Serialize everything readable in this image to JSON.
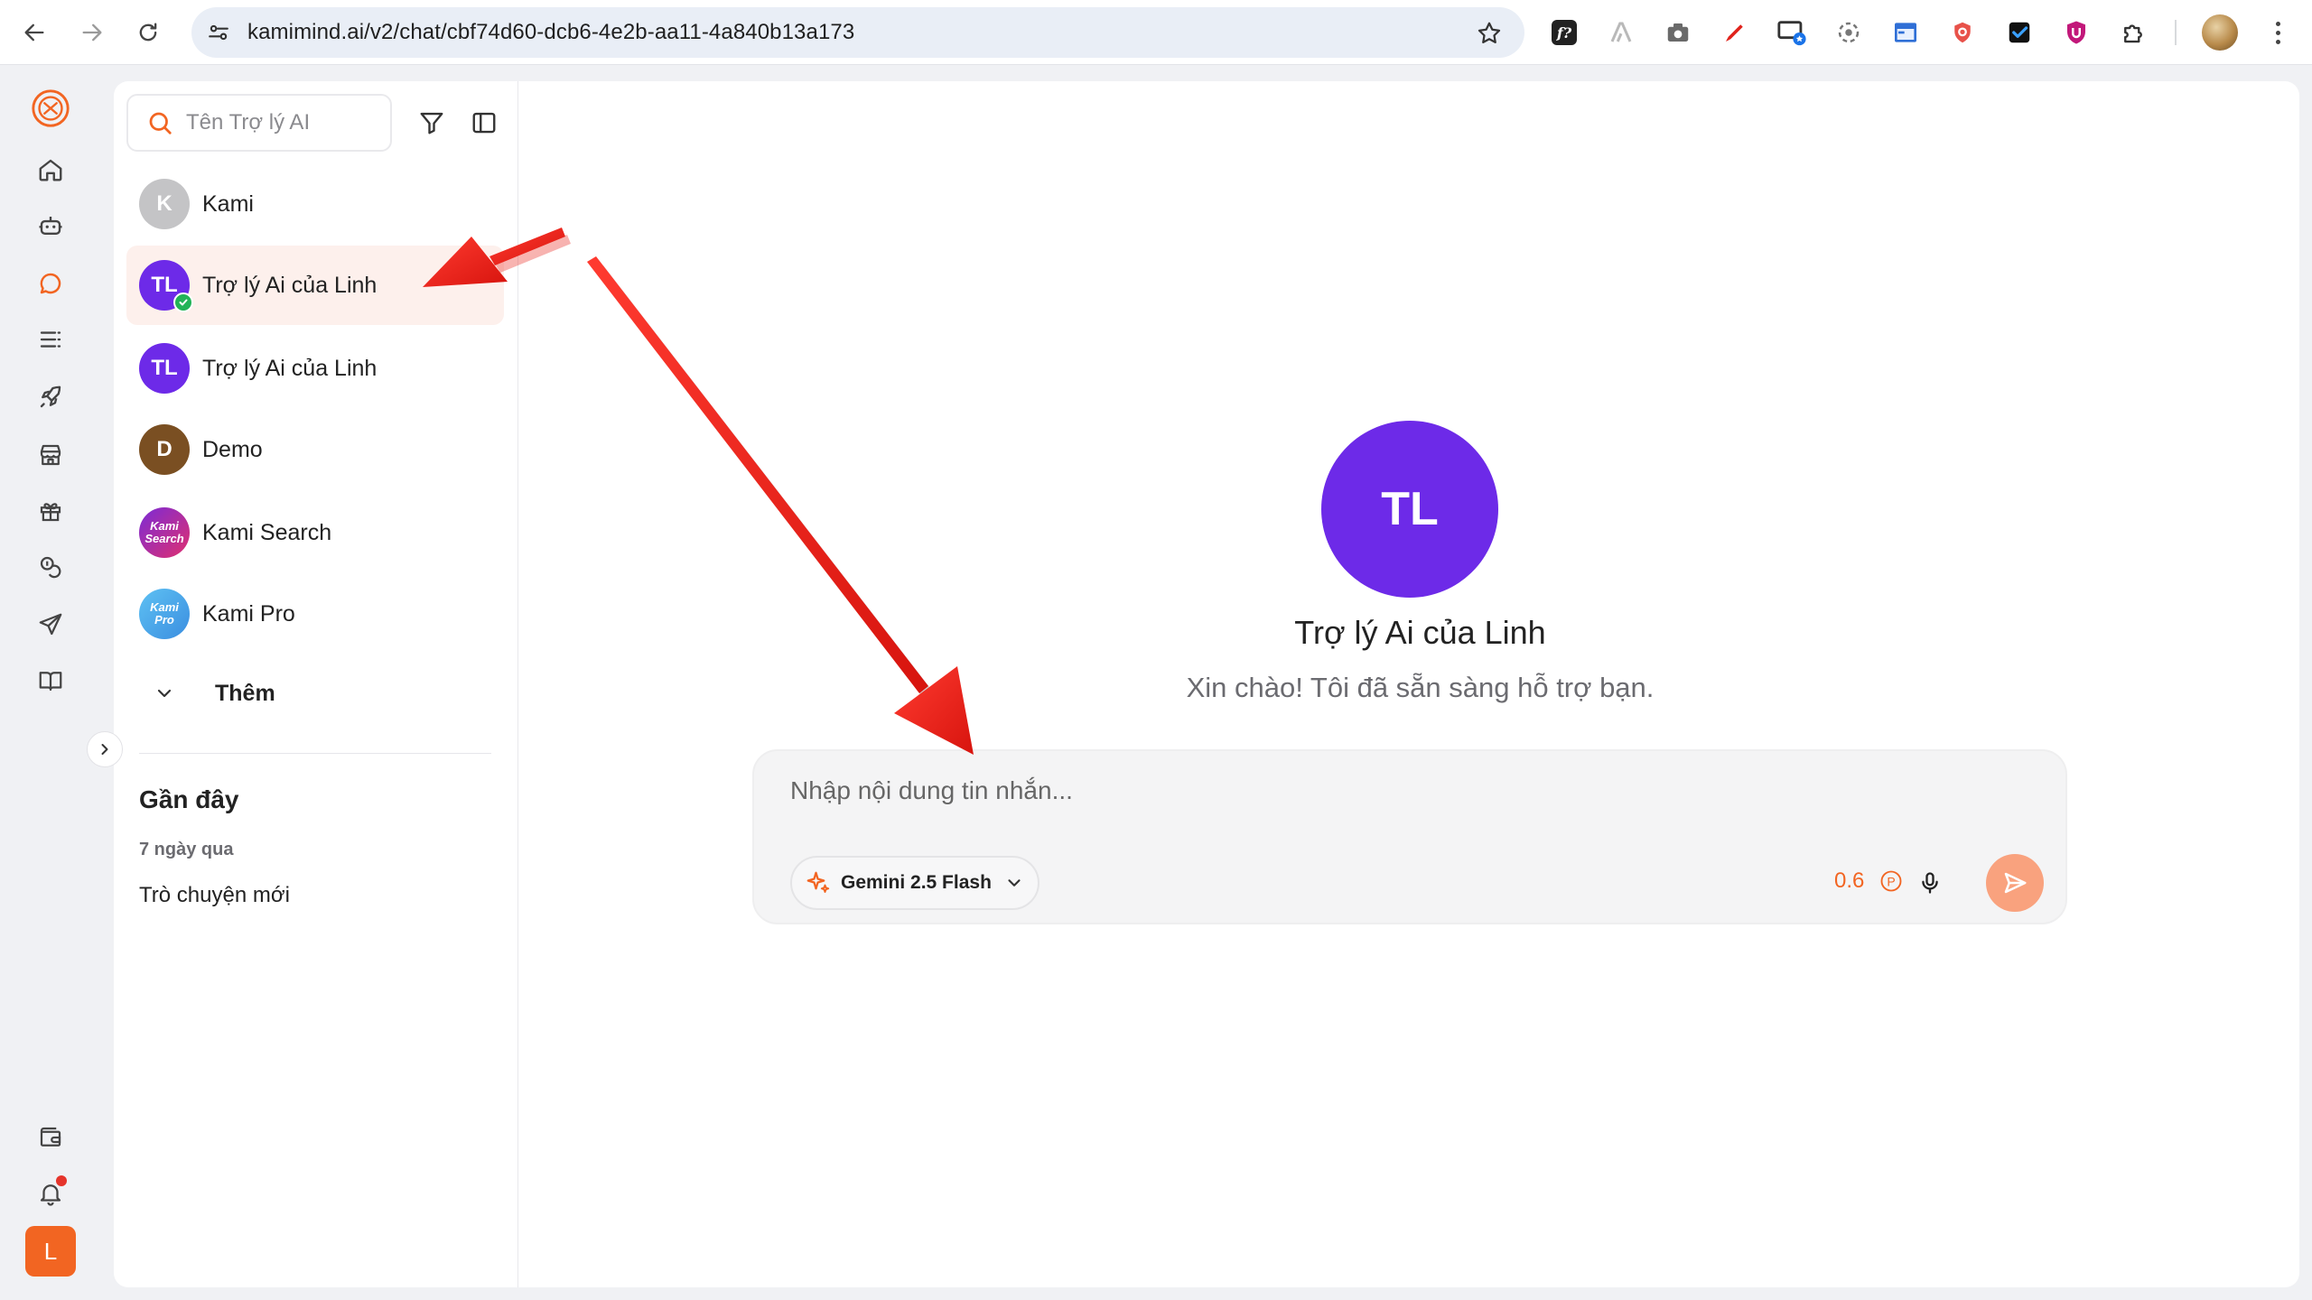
{
  "browser": {
    "url": "kamimind.ai/v2/chat/cbf74d60-dcb6-4e2b-aa11-4a840b13a173",
    "extensions": [
      "formula-icon",
      "ai-icon",
      "camera-icon",
      "pen-icon",
      "screen-star-icon",
      "settings-swirl-icon",
      "window-icon",
      "shield-icon",
      "checkbox-icon",
      "u-badge-icon",
      "puzzle-icon"
    ]
  },
  "rail": {
    "items": [
      "home-icon",
      "bot-icon",
      "chat-icon",
      "list-icon",
      "rocket-icon",
      "store-icon",
      "gift-icon",
      "coins-icon",
      "send-icon",
      "book-icon"
    ],
    "bottom": [
      "wallet-icon",
      "bell-icon"
    ],
    "user_initial": "L"
  },
  "sidebar": {
    "search_placeholder": "Tên Trợ lý AI",
    "assistants": [
      {
        "name": "Kami",
        "initials": "K",
        "color": "#c4c4c6",
        "active": false
      },
      {
        "name": "Trợ lý Ai của Linh",
        "initials": "TL",
        "color": "#6d2ae8",
        "active": true
      },
      {
        "name": "Trợ lý Ai của Linh",
        "initials": "TL",
        "color": "#6d2ae8",
        "active": false
      },
      {
        "name": "Demo",
        "initials": "D",
        "color": "#7a4f22",
        "active": false
      },
      {
        "name": "Kami Search",
        "initials": "Kami Search",
        "color": "#b3268f",
        "active": false
      },
      {
        "name": "Kami Pro",
        "initials": "Kami Pro",
        "color": "#4fa6e8",
        "active": false
      }
    ],
    "more_label": "Thêm",
    "recent_title": "Gần đây",
    "recent_group": "7 ngày qua",
    "recent_items": [
      "Trò chuyện mới"
    ]
  },
  "main": {
    "avatar_initials": "TL",
    "assistant_name": "Trợ lý Ai của Linh",
    "greeting": "Xin chào! Tôi đã sẵn sàng hỗ trợ bạn.",
    "input_placeholder": "Nhập nội dung tin nhắn...",
    "model_label": "Gemini 2.5 Flash",
    "credit_value": "0.6",
    "credit_unit": "P"
  },
  "colors": {
    "accent": "#f26522",
    "brand_purple": "#6d2ae8",
    "annotation_red": "#e8211b"
  }
}
